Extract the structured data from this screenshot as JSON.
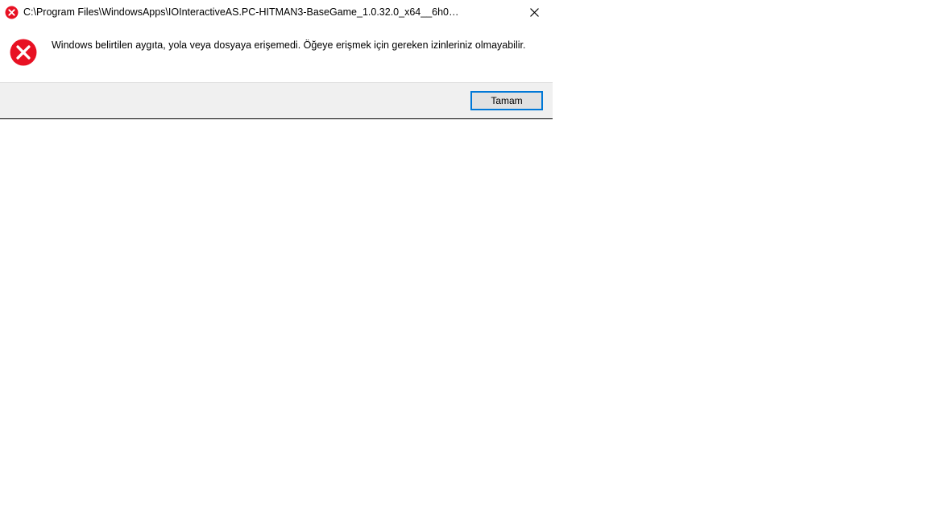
{
  "dialog": {
    "title": "C:\\Program Files\\WindowsApps\\IOInteractiveAS.PC-HITMAN3-BaseGame_1.0.32.0_x64__6h0…",
    "message": "Windows belirtilen aygıta, yola veya dosyaya erişemedi.  Öğeye erişmek için gereken izinleriniz olmayabilir.",
    "ok_label": "Tamam"
  }
}
